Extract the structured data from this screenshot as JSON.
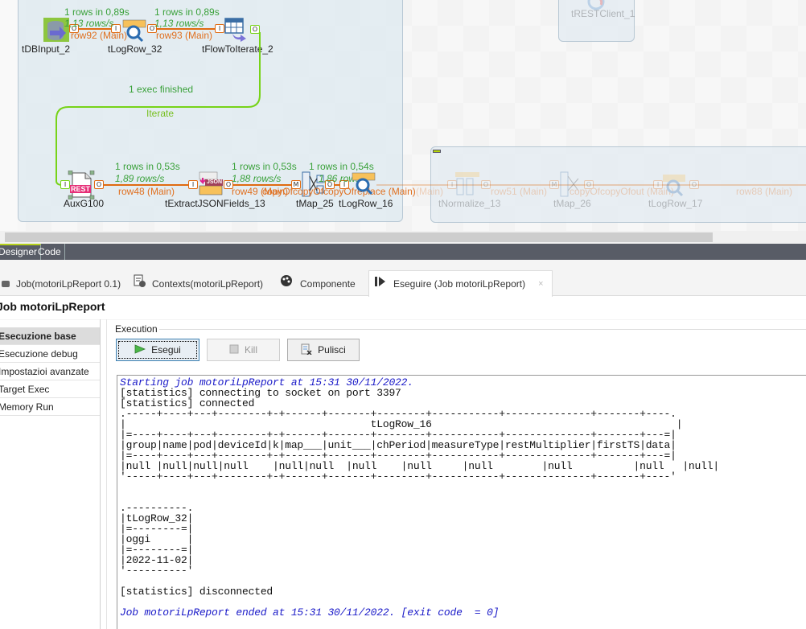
{
  "canvas": {
    "subjob1": {
      "nodes": [
        {
          "name": "tDBInput_2"
        },
        {
          "name": "tLogRow_32"
        },
        {
          "name": "tFlowToIterate_2"
        }
      ],
      "links": [
        {
          "stat_rows": "1 rows in 0,89s",
          "stat_rate": "1,13 rows/s",
          "label": "row92 (Main)"
        },
        {
          "stat_rows": "1 rows in 0,89s",
          "stat_rate": "1,13 rows/s",
          "label": "row93 (Main)"
        }
      ]
    },
    "iterate": {
      "status": "1 exec finished",
      "label": "Iterate"
    },
    "subjob2": {
      "nodes": [
        {
          "name": "AuxG100",
          "badge": "REST"
        },
        {
          "name": "tExtractJSONFields_13",
          "badge": "JSON"
        },
        {
          "name": "tMap_25"
        },
        {
          "name": "tLogRow_16"
        }
      ],
      "links": [
        {
          "stat_rows": "1 rows in 0,53s",
          "stat_rate": "1,89 rows/s",
          "label": "row48 (Main)"
        },
        {
          "stat_rows": "1 rows in 0,53s",
          "stat_rate": "1,88 rows/s",
          "label": "row49 (Main)"
        },
        {
          "stat_rows": "1 rows in 0,54s",
          "stat_rate": "1,86 rows/s",
          "label": "copyOfcopyOfcopyOfreplace (Main)"
        }
      ]
    },
    "subjob3": {
      "nodes": [
        {
          "name": "tNormalize_13"
        },
        {
          "name": "tMap_26"
        },
        {
          "name": "tLogRow_17"
        }
      ],
      "links": [
        {
          "label": "(Main)"
        },
        {
          "label": "row51 (Main)"
        },
        {
          "label": "copyOfcopyOfout (Main)"
        },
        {
          "label": "row88 (Main)"
        }
      ]
    },
    "top_faded_node": "tRESTClient_1",
    "port_labels": {
      "in": "I",
      "out": "O",
      "main": "M"
    }
  },
  "designer_tabs": [
    {
      "label": "Designer",
      "active": true
    },
    {
      "label": "Code",
      "active": false
    }
  ],
  "view_tabs": [
    {
      "label": "Job(motoriLpReport 0.1)",
      "icon": "job-icon"
    },
    {
      "label": "Contexts(motoriLpReport)",
      "icon": "contexts-icon"
    },
    {
      "label": "Componente",
      "icon": "palette-icon"
    },
    {
      "label": "Eseguire (Job motoriLpReport)",
      "icon": "run-icon",
      "active": true,
      "close": "×"
    }
  ],
  "job_title": "Job motoriLpReport",
  "left_menu": [
    {
      "label": "Esecuzione base",
      "active": true
    },
    {
      "label": "Esecuzione debug"
    },
    {
      "label": "Impostazioi avanzate"
    },
    {
      "label": "Target Exec"
    },
    {
      "label": "Memory Run"
    }
  ],
  "execution": {
    "legend": "Execution",
    "run_label": "Esegui",
    "kill_label": "Kill",
    "clear_label": "Pulisci"
  },
  "console": {
    "start_line": "Starting job motoriLpReport at 15:31 30/11/2022.",
    "lines_pre": [
      "[statistics] connecting to socket on port 3397",
      "[statistics] connected"
    ],
    "table1": [
      ".-----+----+---+--------+-+------+-------+--------+-----------+--------------+-------+----.",
      "|                                        tLogRow_16                                        |",
      "|=----+----+---+--------+-+------+-------+--------+-----------+--------------+-------+---=|",
      "|group|name|pod|deviceId|k|map___|unit___|chPeriod|measureType|restMultiplier|firstTS|data|",
      "|=----+----+---+--------+-+------+-------+--------+-----------+--------------+-------+---=|",
      "|null |null|null|null    |null|null  |null    |null     |null        |null          |null   |null|",
      "'-----+----+---+--------+-+------+-------+--------+-----------+--------------+-------+----'"
    ],
    "table2": [
      ".----------.",
      "|tLogRow_32|",
      "|=--------=|",
      "|oggi      |",
      "|=--------=|",
      "|2022-11-02|",
      "'----------'"
    ],
    "disconnect_line": "[statistics] disconnected",
    "end_line": "Job motoriLpReport ended at 15:31 30/11/2022. [exit code  = 0]"
  }
}
